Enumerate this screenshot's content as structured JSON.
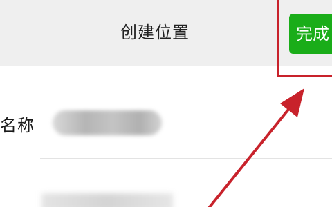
{
  "header": {
    "title": "创建位置",
    "done_label": "完成"
  },
  "form": {
    "name_label": "名称"
  },
  "colors": {
    "header_bg": "#efefef",
    "accent_green": "#1aad19",
    "annotation_red": "#c8222b"
  }
}
